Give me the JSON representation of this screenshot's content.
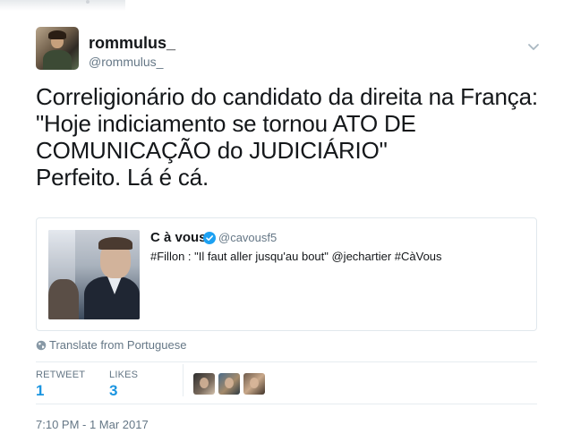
{
  "tweet": {
    "author": {
      "display_name": "rommulus_",
      "handle": "@rommulus_"
    },
    "text": "Correligionário do candidato da direita na França:\n\"Hoje indiciamento se tornou ATO DE\nCOMUNICAÇÃO do JUDICIÁRIO\"\nPerfeito. Lá é cá.",
    "quoted_tweet": {
      "display_name": "C à vous",
      "verified": true,
      "handle": "@cavousf5",
      "text": "#Fillon : \"Il faut aller jusqu'au bout\" @jechartier #CàVous"
    },
    "translate_label": "Translate from Portuguese",
    "stats": {
      "retweets_label": "RETWEET",
      "retweets_value": "1",
      "likes_label": "LIKES",
      "likes_value": "3"
    },
    "likers_count_shown": 3,
    "timestamp": "7:10 PM - 1 Mar 2017"
  },
  "icons": {
    "caret": "chevron-down-icon",
    "verified": "verified-badge-icon",
    "translate": "globe-icon"
  },
  "colors": {
    "link_blue": "#1b95e0",
    "secondary_text": "#657786",
    "verified_blue": "#1da1f2",
    "divider": "#e6ecf0"
  }
}
